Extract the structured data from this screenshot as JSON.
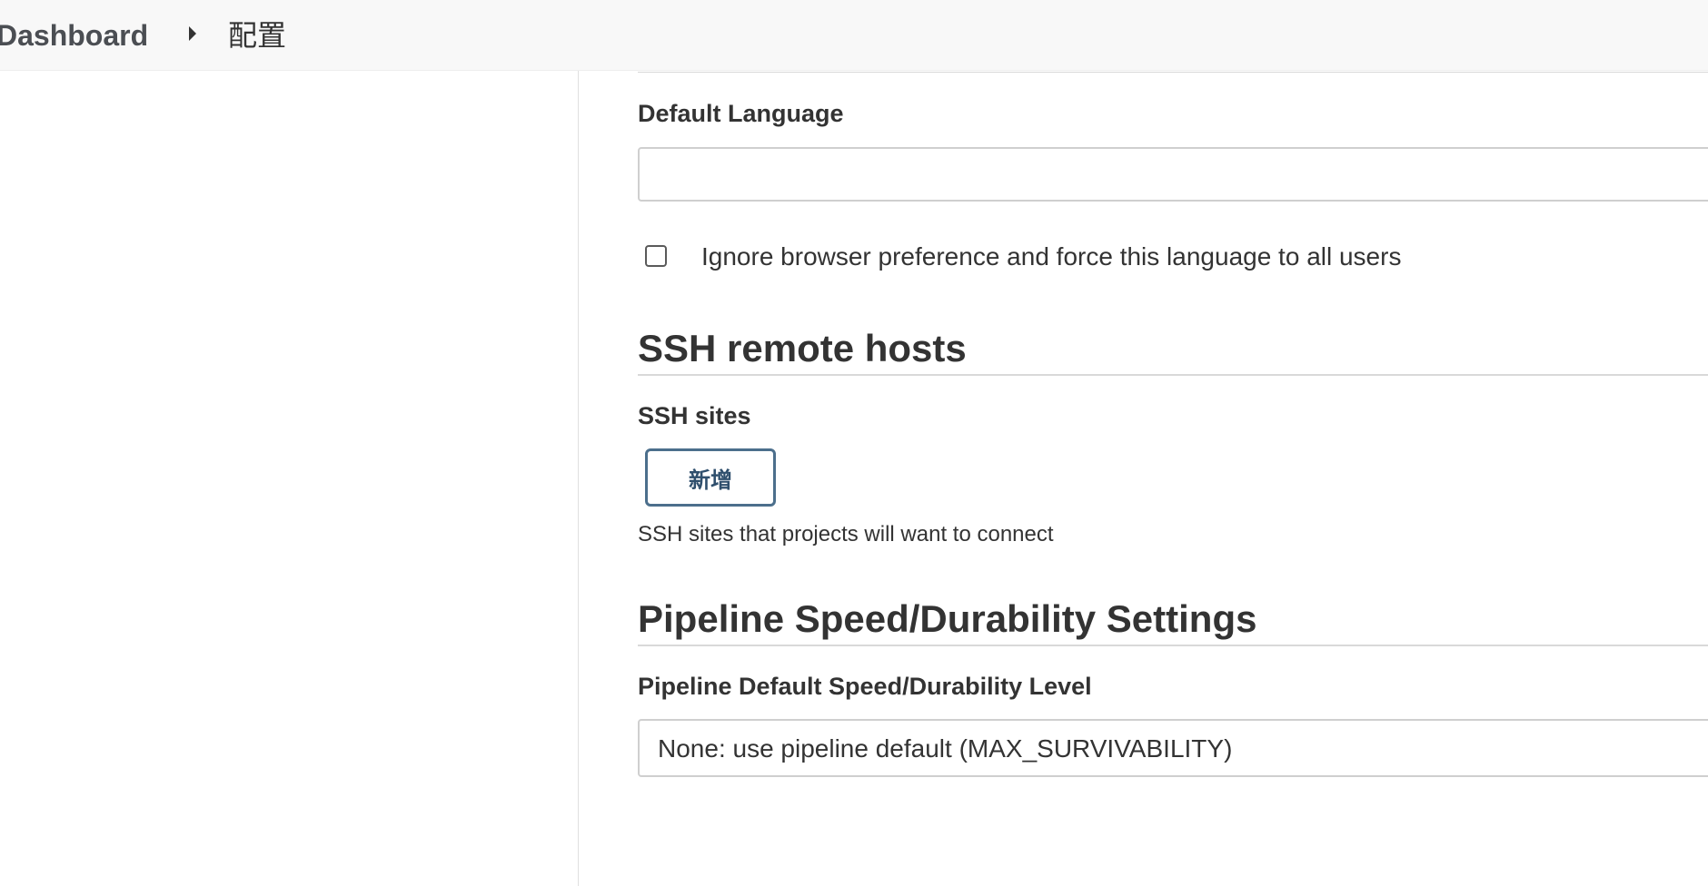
{
  "breadcrumb": {
    "items": [
      "Dashboard",
      "配置"
    ]
  },
  "form": {
    "default_language": {
      "label": "Default Language",
      "value": "",
      "placeholder": ""
    },
    "ignore_browser_pref": {
      "label": "Ignore browser preference and force this language to all users",
      "checked": false
    }
  },
  "ssh_section": {
    "heading": "SSH remote hosts",
    "sites_label": "SSH sites",
    "add_button": "新增",
    "help": "SSH sites that projects will want to connect"
  },
  "pipeline_section": {
    "heading": "Pipeline Speed/Durability Settings",
    "level_label": "Pipeline Default Speed/Durability Level",
    "level_value": "None: use pipeline default (MAX_SURVIVABILITY)"
  }
}
